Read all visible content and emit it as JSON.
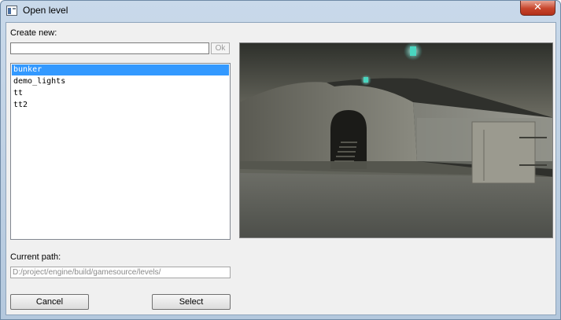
{
  "window": {
    "title": "Open level",
    "close_glyph": "✕"
  },
  "create_new": {
    "label": "Create new:",
    "value": "",
    "ok_label": "Ok"
  },
  "levels": {
    "items": [
      "bunker",
      "demo_lights",
      "tt",
      "tt2"
    ],
    "selected": "bunker"
  },
  "preview": {
    "icon": "level-preview-image"
  },
  "current_path": {
    "label": "Current path:",
    "value": "D:/project/engine/build/gamesource/levels/"
  },
  "buttons": {
    "cancel_label": "Cancel",
    "select_label": "Select"
  },
  "colors": {
    "selection": "#3399ff",
    "close_button": "#c7452b"
  }
}
